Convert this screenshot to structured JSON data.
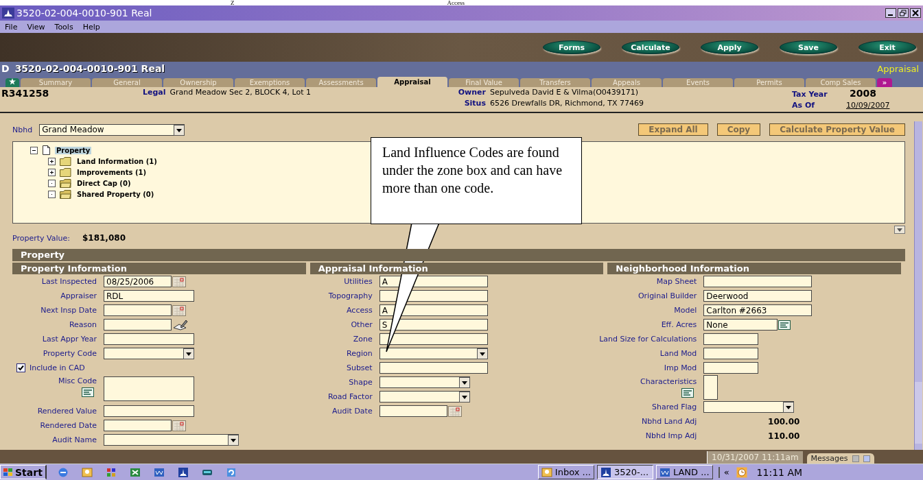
{
  "top_strip": {
    "texts": [
      "Z",
      "Access"
    ]
  },
  "window": {
    "title": "3520-02-004-0010-901 Real"
  },
  "menu": [
    "File",
    "View",
    "Tools",
    "Help"
  ],
  "toolbar": {
    "buttons": [
      "Forms",
      "Calculate",
      "Apply",
      "Save",
      "Exit"
    ]
  },
  "record_header": {
    "badge": "D",
    "title": "3520-02-004-0010-901 Real",
    "section": "Appraisal"
  },
  "tabs": [
    {
      "kind": "home",
      "selected": false
    },
    {
      "kind": "page",
      "label": "Summary",
      "selected": false
    },
    {
      "kind": "page",
      "label": "General",
      "selected": false
    },
    {
      "kind": "page",
      "label": "Ownership",
      "selected": false
    },
    {
      "kind": "page",
      "label": "Exemptions",
      "selected": false
    },
    {
      "kind": "page",
      "label": "Assessments",
      "selected": false
    },
    {
      "kind": "page",
      "label": "Appraisal",
      "selected": true
    },
    {
      "kind": "page",
      "label": "Final Value",
      "selected": false
    },
    {
      "kind": "page",
      "label": "Transfers",
      "selected": false
    },
    {
      "kind": "page",
      "label": "Appeals",
      "selected": false
    },
    {
      "kind": "page",
      "label": "Events",
      "selected": false
    },
    {
      "kind": "page",
      "label": "Permits",
      "selected": false
    },
    {
      "kind": "page",
      "label": "Comp Sales",
      "selected": false
    },
    {
      "kind": "more",
      "label": "»",
      "selected": false
    }
  ],
  "record": {
    "id": "R341258",
    "legal_label": "Legal",
    "legal": "Grand Meadow Sec 2, BLOCK 4, Lot 1",
    "owner_label": "Owner",
    "owner": "Sepulveda David E & Vilma(O0439171)",
    "situs_label": "Situs",
    "situs": "6526 Drewfalls DR, Richmond, TX 77469",
    "tax_year_label": "Tax Year",
    "tax_year": "2008",
    "as_of_label": "As Of",
    "as_of": "10/09/2007"
  },
  "nbhd": {
    "label": "Nbhd",
    "value": "Grand Meadow"
  },
  "actions": [
    "Expand All",
    "Copy",
    "Calculate Property Value"
  ],
  "tree": [
    {
      "label": "Property",
      "kind": "document",
      "expanded": true,
      "selected": true,
      "children": [
        {
          "label": "Land Information (1)",
          "kind": "folder",
          "expanded": false,
          "selected": false
        },
        {
          "label": "Improvements (1)",
          "kind": "folder",
          "expanded": false,
          "selected": false
        },
        {
          "label": "Direct Cap (0)",
          "kind": "empty-folder",
          "expanded": false,
          "selected": false
        },
        {
          "label": "Shared Property (0)",
          "kind": "empty-folder",
          "expanded": false,
          "selected": false
        }
      ]
    }
  ],
  "callout": {
    "text": "Land Influence Codes are found under the zone box and can have more than one code."
  },
  "property_value": {
    "label": "Property Value:",
    "value": "$181,080"
  },
  "section": {
    "title": "Property",
    "columns": [
      {
        "title": "Property Information",
        "fields": [
          {
            "label": "Last Inspected",
            "kind": "date",
            "value": "08/25/2006"
          },
          {
            "label": "Appraiser",
            "kind": "text",
            "value": "RDL"
          },
          {
            "label": "Next Insp Date",
            "kind": "date"
          },
          {
            "label": "Reason",
            "kind": "reason"
          },
          {
            "label": "Last Appr Year",
            "kind": "text"
          },
          {
            "label": "Property Code",
            "kind": "select"
          },
          {
            "label": "Include in CAD",
            "kind": "checkbox",
            "checked": true
          },
          {
            "label": "Misc Code",
            "kind": "memo"
          },
          {
            "label": "Rendered Value",
            "kind": "text"
          },
          {
            "label": "Rendered Date",
            "kind": "date"
          },
          {
            "label": "Audit Name",
            "kind": "long-select"
          }
        ]
      },
      {
        "title": "Appraisal Information",
        "fields": [
          {
            "label": "Utilities",
            "kind": "text",
            "value": "A"
          },
          {
            "label": "Topography",
            "kind": "text"
          },
          {
            "label": "Access",
            "kind": "text",
            "value": "A"
          },
          {
            "label": "Other",
            "kind": "text",
            "value": "S"
          },
          {
            "label": "Zone",
            "kind": "text"
          },
          {
            "label": "Region",
            "kind": "select"
          },
          {
            "label": "Subset",
            "kind": "text"
          },
          {
            "label": "Shape",
            "kind": "short-select"
          },
          {
            "label": "Road Factor",
            "kind": "short-select"
          },
          {
            "label": "Audit Date",
            "kind": "date"
          }
        ]
      },
      {
        "title": "Neighborhood Information",
        "fields": [
          {
            "label": "Map Sheet",
            "kind": "text"
          },
          {
            "label": "Original Builder",
            "kind": "text",
            "value": "Deerwood"
          },
          {
            "label": "Model",
            "kind": "text",
            "value": "Carlton #2663"
          },
          {
            "label": "Eff. Acres",
            "kind": "list",
            "value": "None"
          },
          {
            "label": "Land Size for Calculations",
            "kind": "short-text"
          },
          {
            "label": "Land Mod",
            "kind": "short-text"
          },
          {
            "label": "Imp Mod",
            "kind": "short-text"
          },
          {
            "label": "Characteristics",
            "kind": "narrow-memo"
          },
          {
            "label": "Shared Flag",
            "kind": "short-select"
          },
          {
            "label": "Nbhd Land Adj",
            "kind": "value",
            "value": "100.00"
          },
          {
            "label": "Nbhd Imp Adj",
            "kind": "value",
            "value": "110.00"
          }
        ]
      }
    ]
  },
  "status_bar": {
    "datetime": "10/31/2007 11:11am",
    "messages": "Messages"
  },
  "taskbar": {
    "start": "Start",
    "tasks": [
      {
        "label": "Inbox ...",
        "selected": false
      },
      {
        "label": "3520-...",
        "selected": true
      },
      {
        "label": "LAND ...",
        "selected": false
      }
    ],
    "tray_toggle": "«",
    "clock": "11:11 AM"
  }
}
